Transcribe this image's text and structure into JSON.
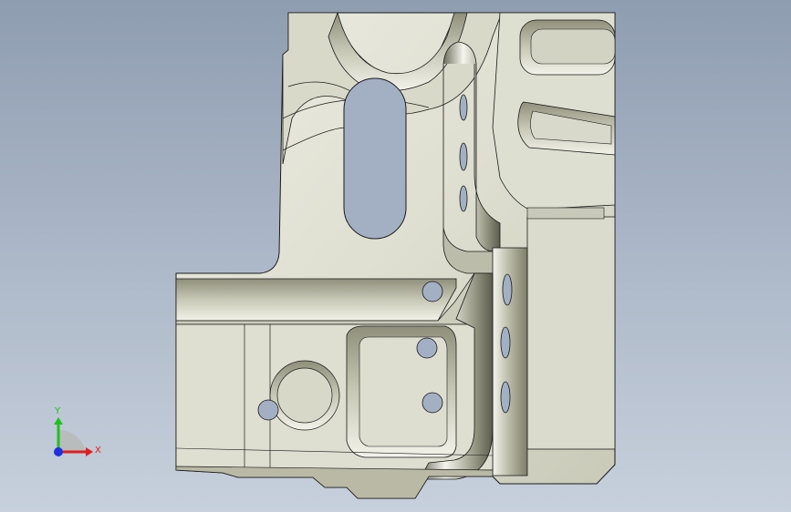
{
  "viewport": {
    "background_top": "#8f9db1",
    "background_bottom": "#c7d0dc",
    "part_fill": "#e4e4d8",
    "part_shade": "#9a9a88",
    "edge_color": "#1a1a1a",
    "hole_fill": "#a3b0c4"
  },
  "triad": {
    "x_label": "X",
    "y_label": "Y",
    "x_color": "#e02020",
    "y_color": "#20c020",
    "z_color": "#2030e0"
  }
}
